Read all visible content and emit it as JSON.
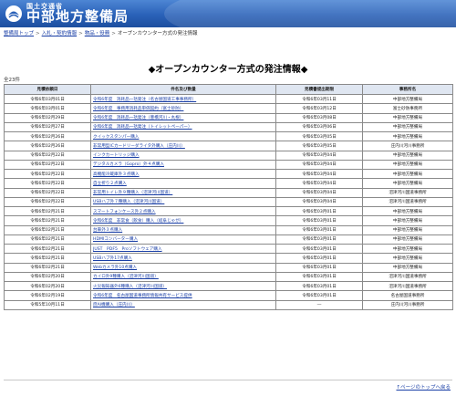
{
  "header": {
    "org_sub": "国土交通省",
    "org_name": "中部地方整備局",
    "bg_color": "#2a61b8"
  },
  "breadcrumb": {
    "items": [
      "整備局トップ",
      "入札・契約情報",
      "物品・役務",
      "オープンカウンター方式の発注情報"
    ],
    "separator": ">"
  },
  "page_title": "◆オープンカウンター方式の発注情報◆",
  "total_count": "全23件",
  "table": {
    "headers": [
      "見積依頼日",
      "件名及び数量",
      "見積書提出期限",
      "事務所名"
    ],
    "rows": [
      {
        "date": "令和6年03月01日",
        "item": "令和6年度　消耗品一括発注（名古屋国道工事事務所）",
        "deadline": "令和6年03月11日",
        "office": "中部地方整備局"
      },
      {
        "date": "令和6年03月01日",
        "item": "令和6年度　事務用消耗品単価契約（富士砂防）",
        "deadline": "令和6年03月12日",
        "office": "富士砂防事務所"
      },
      {
        "date": "令和6年02月29日",
        "item": "令和6年度　消耗品一括発注（豊橋河川・丸根）",
        "deadline": "令和6年03月08日",
        "office": "中部地方整備局"
      },
      {
        "date": "令和6年02月27日",
        "item": "令和6年度　消耗品一括発注（トイレットペーパー）",
        "deadline": "令和6年03月06日",
        "office": "中部地方整備局"
      },
      {
        "date": "令和6年02月26日",
        "item": "クイックスタンパー購入",
        "deadline": "令和6年03月05日",
        "office": "中部地方整備局"
      },
      {
        "date": "令和6年02月26日",
        "item": "非常用型ICカードリーダライタ外購入（庄内川）",
        "deadline": "令和6年03月05日",
        "office": "庄内川河川事務所"
      },
      {
        "date": "令和6年02月22日",
        "item": "インクカートリッジ購入",
        "deadline": "令和6年03月04日",
        "office": "中部地方整備局"
      },
      {
        "date": "令和6年02月22日",
        "item": "デジタルカメラ（Gopro）外４点購入",
        "deadline": "令和6年03月04日",
        "office": "中部地方整備局"
      },
      {
        "date": "令和6年02月22日",
        "item": "高機能冷蔵庫外３点購入",
        "deadline": "令和6年03月04日",
        "office": "中部地方整備局"
      },
      {
        "date": "令和6年02月22日",
        "item": "自立折り２点購入",
        "deadline": "令和6年03月04日",
        "office": "中部地方整備局"
      },
      {
        "date": "令和6年02月22日",
        "item": "非常用トイレ外９種購入（沼津河川国道）",
        "deadline": "令和6年03月04日",
        "office": "沼津河川国道事務所"
      },
      {
        "date": "令和6年02月22日",
        "item": "USBハブ外７種購入（沼津河川国道）",
        "deadline": "令和6年03月04日",
        "office": "沼津河川国道事務所"
      },
      {
        "date": "令和6年02月21日",
        "item": "スマートフォンケース外２点購入",
        "deadline": "令和6年03月01日",
        "office": "中部地方整備局"
      },
      {
        "date": "令和6年02月21日",
        "item": "令和6年度　非常食（飲食）購入（岐阜じゃが）",
        "deadline": "令和6年03月01日",
        "office": "中部地方整備局"
      },
      {
        "date": "令和6年02月21日",
        "item": "台車外３点購入",
        "deadline": "令和6年03月01日",
        "office": "中部地方整備局"
      },
      {
        "date": "令和6年02月21日",
        "item": "HDMIコンバーター購入",
        "deadline": "令和6年03月01日",
        "office": "中部地方整備局"
      },
      {
        "date": "令和6年02月21日",
        "item": "JUST　PDF5　Proソフトウェア購入",
        "deadline": "令和6年03月01日",
        "office": "中部地方整備局"
      },
      {
        "date": "令和6年02月21日",
        "item": "USBハブ外17点購入",
        "deadline": "令和6年03月01日",
        "office": "中部地方整備局"
      },
      {
        "date": "令和6年02月21日",
        "item": "Webカメラ外10点購入",
        "deadline": "令和6年03月01日",
        "office": "中部地方整備局"
      },
      {
        "date": "令和6年02月20日",
        "item": "カイロ外9種購入（沼津河川国道）",
        "deadline": "令和6年03月01日",
        "office": "沼津河川国道事務所"
      },
      {
        "date": "令和6年02月20日",
        "item": "火災報知器外6種購入（沼津河川国道）",
        "deadline": "令和6年03月01日",
        "office": "沼津河川国道事務所"
      },
      {
        "date": "令和6年02月19日",
        "item": "令和6年度　名古屋国道事務所情報共有サービス提供",
        "deadline": "令和6年03月01日",
        "office": "名古屋国道事務所"
      },
      {
        "date": "令和5年10月11日",
        "item": "庶AI機購入（庄内川）",
        "deadline": "―",
        "office": "庄内川河川事務所"
      }
    ]
  },
  "footer": {
    "page_top_link": "↑ページのトップへ戻る"
  }
}
